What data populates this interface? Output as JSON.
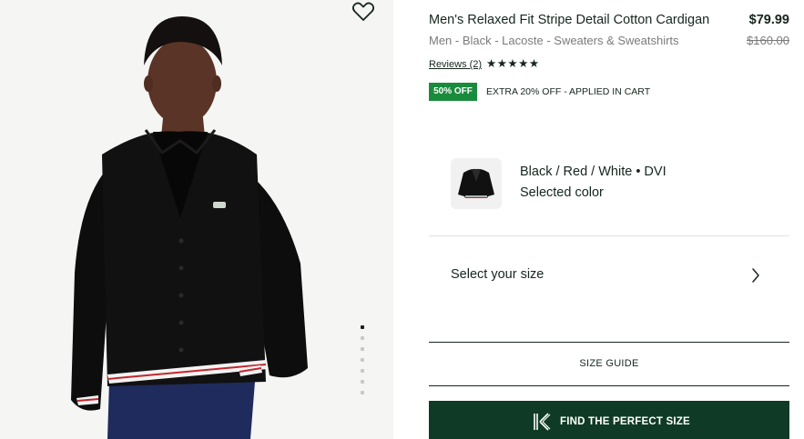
{
  "product": {
    "title": "Men's Relaxed Fit Stripe Detail Cotton Cardigan",
    "price": "$79.99",
    "original_price": "$160.00",
    "breadcrumb": "Men - Black - Lacoste - Sweaters & Sweatshirts",
    "reviews_label": "Reviews (2)",
    "rating_stars": "★★★★★",
    "rating": 5
  },
  "promo": {
    "badge": "50% OFF",
    "text": "EXTRA 20% OFF - APPLIED IN CART",
    "badge_color": "#1a8b3d"
  },
  "color": {
    "name": "Black / Red / White • DVI",
    "subtitle": "Selected color"
  },
  "size": {
    "label": "Select your size"
  },
  "buttons": {
    "size_guide": "SIZE GUIDE",
    "find_size": "FIND THE PERFECT SIZE",
    "primary_color": "#0f3b26"
  },
  "gallery": {
    "total_images": 7,
    "active_index": 0
  },
  "icons": {
    "wishlist": "heart-icon",
    "chevron": "chevron-right-icon",
    "fit": "fit-finder-icon"
  }
}
